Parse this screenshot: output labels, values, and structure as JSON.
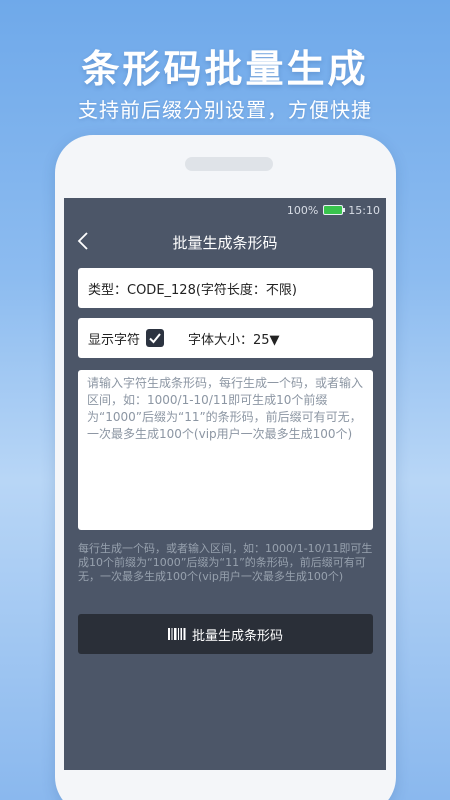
{
  "promo": {
    "title": "条形码批量生成",
    "subtitle": "支持前后缀分别设置，方便快捷"
  },
  "status_bar": {
    "battery_percent": "100%",
    "time": "15:10"
  },
  "app_bar": {
    "back_icon": "chevron-left-icon",
    "title": "批量生成条形码"
  },
  "barcode_type": {
    "label": "类型：CODE_128(字符长度：不限)"
  },
  "options": {
    "show_chars_label": "显示字符",
    "show_chars_checked": true,
    "font_size_label": "字体大小：25▼"
  },
  "input": {
    "placeholder": "请输入字符生成条形码，每行生成一个码，或者输入区间，如：1000/1-10/11即可生成10个前缀为“1000”后缀为“11”的条形码，前后缀可有可无，一次最多生成100个(vip用户一次最多生成100个)"
  },
  "hint": "每行生成一个码，或者输入区间，如：1000/1-10/11即可生成10个前缀为“1000”后缀为“11”的条形码，前后缀可有可无，一次最多生成100个(vip用户一次最多生成100个)",
  "generate_button": {
    "icon": "barcode-icon",
    "label": "批量生成条形码"
  },
  "colors": {
    "screen_bg": "#4c5668",
    "button_bg": "#2a2f38",
    "battery": "#39c34d"
  }
}
